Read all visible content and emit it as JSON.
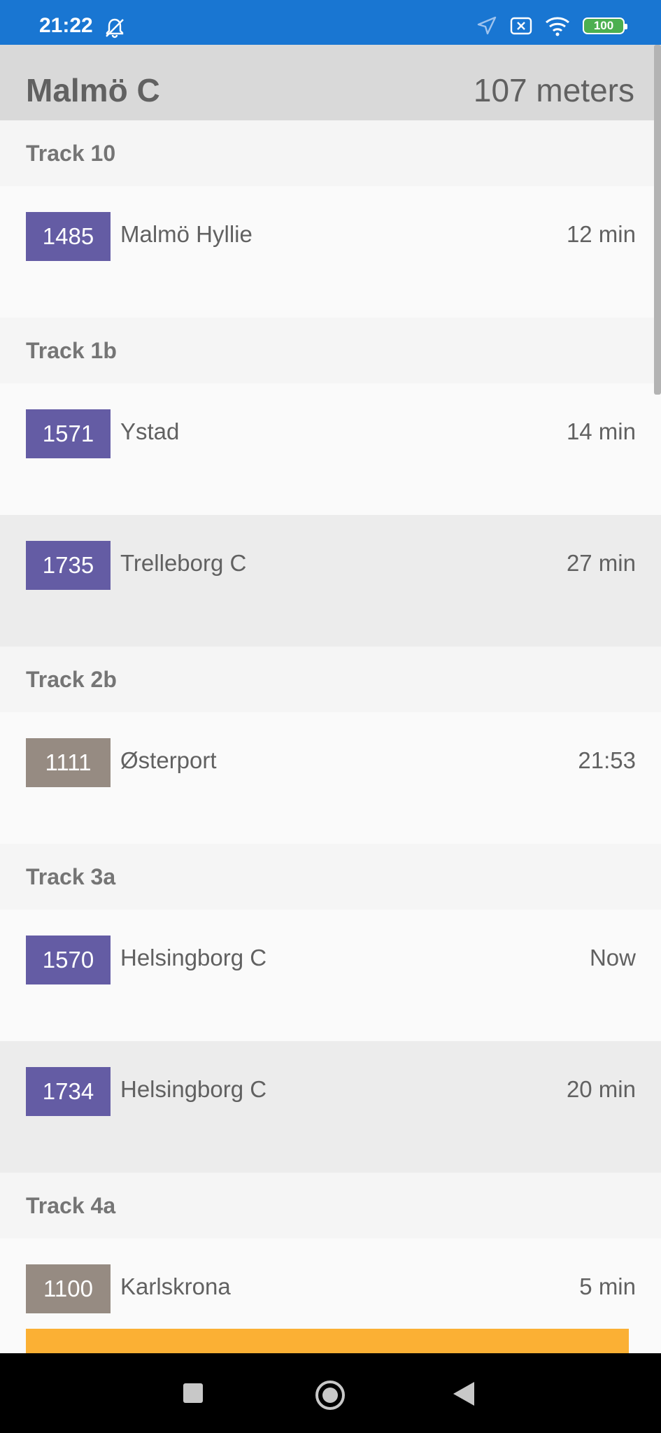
{
  "status_bar": {
    "time": "21:22",
    "battery": "100",
    "icons": [
      "bell-off-icon",
      "location-arrow-icon",
      "sim-off-icon",
      "wifi-icon",
      "battery-icon"
    ],
    "background_color": "#1976d2",
    "battery_color": "#4caf50"
  },
  "station": {
    "name": "Malmö C",
    "distance": "107 meters"
  },
  "colors": {
    "badge_regional": "#645ca4",
    "badge_other": "#968b82",
    "banner": "#fbb034"
  },
  "tracks": [
    {
      "label": "Track 10",
      "departures": [
        {
          "line": "1485",
          "destination": "Malmö Hyllie",
          "time": "12 min",
          "badge": "regional"
        }
      ]
    },
    {
      "label": "Track 1b",
      "departures": [
        {
          "line": "1571",
          "destination": "Ystad",
          "time": "14 min",
          "badge": "regional"
        },
        {
          "line": "1735",
          "destination": "Trelleborg C",
          "time": "27 min",
          "badge": "regional"
        }
      ]
    },
    {
      "label": "Track 2b",
      "departures": [
        {
          "line": "1111",
          "destination": "Østerport",
          "time": "21:53",
          "badge": "other"
        }
      ]
    },
    {
      "label": "Track 3a",
      "departures": [
        {
          "line": "1570",
          "destination": "Helsingborg C",
          "time": "Now",
          "badge": "regional"
        },
        {
          "line": "1734",
          "destination": "Helsingborg C",
          "time": "20 min",
          "badge": "regional"
        }
      ]
    },
    {
      "label": "Track 4a",
      "departures": [
        {
          "line": "1100",
          "destination": "Karlskrona",
          "time": "5 min",
          "badge": "other"
        }
      ]
    }
  ],
  "nav_bar": {
    "icons": [
      "recent-apps-icon",
      "home-icon",
      "back-icon"
    ]
  }
}
